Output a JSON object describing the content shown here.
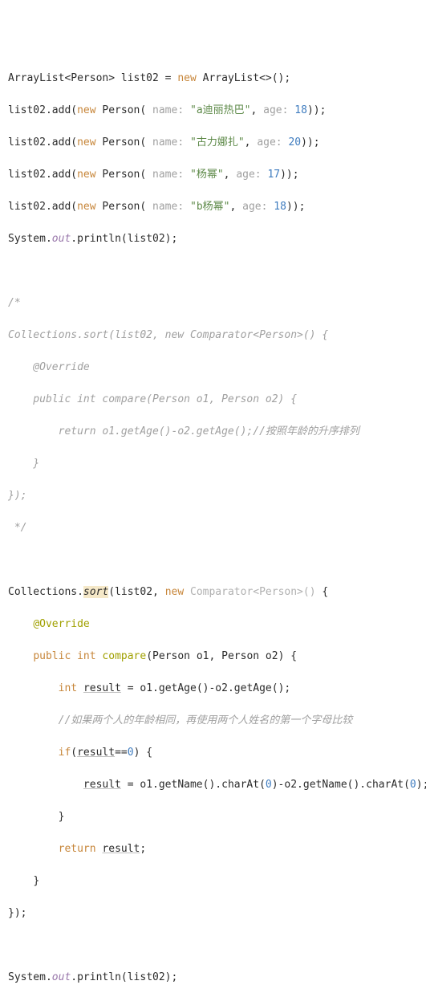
{
  "line01": {
    "t1": "ArrayList<Person> list02 = ",
    "kw": "new",
    "t2": " ArrayList<>();"
  },
  "line02": {
    "t1": "list02.add(",
    "kw": "new",
    "t2": " Person(",
    "h1": " name: ",
    "s1": "\"a迪丽热巴\"",
    "c": ", ",
    "h2": "age: ",
    "n": "18",
    "t3": "));"
  },
  "line03": {
    "t1": "list02.add(",
    "kw": "new",
    "t2": " Person(",
    "h1": " name: ",
    "s1": "\"古力娜扎\"",
    "c": ", ",
    "h2": "age: ",
    "n": "20",
    "t3": "));"
  },
  "line04": {
    "t1": "list02.add(",
    "kw": "new",
    "t2": " Person(",
    "h1": " name: ",
    "s1": "\"杨幂\"",
    "c": ", ",
    "h2": "age: ",
    "n": "17",
    "t3": "));"
  },
  "line05": {
    "t1": "list02.add(",
    "kw": "new",
    "t2": " Person(",
    "h1": " name: ",
    "s1": "\"b杨幂\"",
    "c": ", ",
    "h2": "age: ",
    "n": "18",
    "t3": "));"
  },
  "line06": {
    "t1": "System.",
    "fld": "out",
    "t2": ".println(list02);"
  },
  "comment": {
    "c1": "/*",
    "c2": "Collections.sort(list02, new Comparator<Person>() {",
    "c3": "    @Override",
    "c4": "    public int compare(Person o1, Person o2) {",
    "c5": "        return o1.getAge()-o2.getAge();//按照年龄的升序排列",
    "c6": "    }",
    "c7": "});",
    "c8": " */"
  },
  "line_sort": {
    "t1": "Collections.",
    "m": "sort",
    "t2": "(list02, ",
    "kw": "new",
    "ctx": " Comparator<Person>()",
    "t3": " {"
  },
  "line_ovr": {
    "ann": "@Override"
  },
  "line_cmp": {
    "kw1": "public",
    "sp1": " ",
    "kw2": "int",
    "sp2": " ",
    "m": "compare",
    "t1": "(Person o1, Person o2) {"
  },
  "line_res": {
    "kw": "int",
    "sp": " ",
    "v": "result",
    "t1": " = o1.getAge()-o2.getAge();"
  },
  "line_cc": {
    "c": "//如果两个人的年龄相同，再使用两个人姓名的第一个字母比较"
  },
  "line_if": {
    "kw": "if",
    "t1": "(",
    "v": "result",
    "t2": "==",
    "n": "0",
    "t3": ") {"
  },
  "line_r2": {
    "v": "result",
    "t1": " = o1.getName().charAt(",
    "n1": "0",
    "t2": ")-o2.getName().charAt(",
    "n2": "0",
    "t3": ");"
  },
  "line_cb1": {
    "t": "}"
  },
  "line_ret": {
    "kw": "return",
    "sp": " ",
    "v": "result",
    "t": ";"
  },
  "line_cb2": {
    "t": "}"
  },
  "line_cb3": {
    "t": "});"
  },
  "line_last": {
    "t1": "System.",
    "fld": "out",
    "t2": ".println(list02);"
  }
}
